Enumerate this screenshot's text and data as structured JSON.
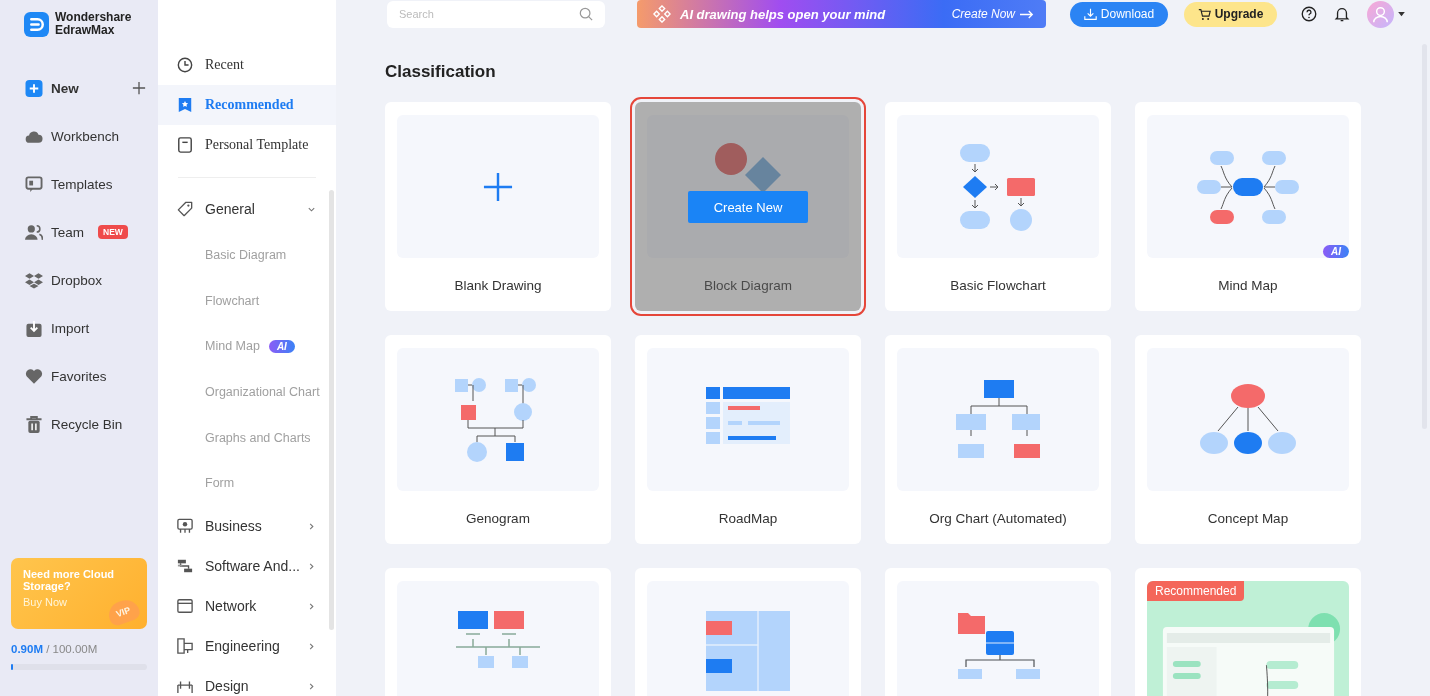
{
  "app": {
    "name_line1": "Wondershare",
    "name_line2": "EdrawMax"
  },
  "nav": [
    {
      "label": "New",
      "selected": false
    },
    {
      "label": "Workbench",
      "selected": false
    },
    {
      "label": "Templates",
      "selected": false
    },
    {
      "label": "Team",
      "selected": false,
      "badge": "NEW"
    },
    {
      "label": "Dropbox",
      "selected": false
    },
    {
      "label": "Import",
      "selected": false
    },
    {
      "label": "Favorites",
      "selected": false
    },
    {
      "label": "Recycle Bin",
      "selected": false
    }
  ],
  "promo": {
    "title": "Need more Cloud Storage?",
    "action": "Buy Now",
    "badge": "VIP"
  },
  "storage": {
    "used": "0.90M",
    "total": "/ 100.00M",
    "level": 0.01
  },
  "panel": {
    "top": [
      {
        "label": "Recent",
        "selected": false
      },
      {
        "label": "Recommended",
        "selected": true
      },
      {
        "label": "Personal Template",
        "selected": false
      }
    ],
    "categories": [
      {
        "label": "General",
        "expanded": true,
        "children": [
          {
            "label": "Basic Diagram"
          },
          {
            "label": "Flowchart"
          },
          {
            "label": "Mind Map",
            "badge": "AI"
          },
          {
            "label": "Organizational Chart"
          },
          {
            "label": "Graphs and Charts"
          },
          {
            "label": "Form"
          }
        ]
      },
      {
        "label": "Business",
        "expanded": false
      },
      {
        "label": "Software And...",
        "expanded": false
      },
      {
        "label": "Network",
        "expanded": false
      },
      {
        "label": "Engineering",
        "expanded": false
      },
      {
        "label": "Design",
        "expanded": false
      }
    ]
  },
  "topbar": {
    "search": {
      "placeholder": "Search"
    },
    "banner": {
      "text": "AI drawing helps open your mind",
      "action": "Create Now"
    },
    "download": "Download",
    "upgrade": "Upgrade"
  },
  "section_title": "Classification",
  "cards": [
    {
      "title": "Blank Drawing",
      "kind": "blank",
      "hovered": false
    },
    {
      "title": "Block Diagram",
      "kind": "block",
      "hovered": true,
      "action": "Create New"
    },
    {
      "title": "Basic Flowchart",
      "kind": "flowchart",
      "hovered": false
    },
    {
      "title": "Mind Map",
      "kind": "mindmap",
      "hovered": false,
      "badge": "AI"
    },
    {
      "title": "Genogram",
      "kind": "genogram",
      "hovered": false
    },
    {
      "title": "RoadMap",
      "kind": "roadmap",
      "hovered": false
    },
    {
      "title": "Org Chart (Automated)",
      "kind": "orgchart",
      "hovered": false
    },
    {
      "title": "Concept Map",
      "kind": "concept",
      "hovered": false
    },
    {
      "kind": "network",
      "hovered": false
    },
    {
      "kind": "layout",
      "hovered": false
    },
    {
      "kind": "folders",
      "hovered": false
    },
    {
      "kind": "template",
      "hovered": false,
      "tag": "Recommended"
    }
  ]
}
